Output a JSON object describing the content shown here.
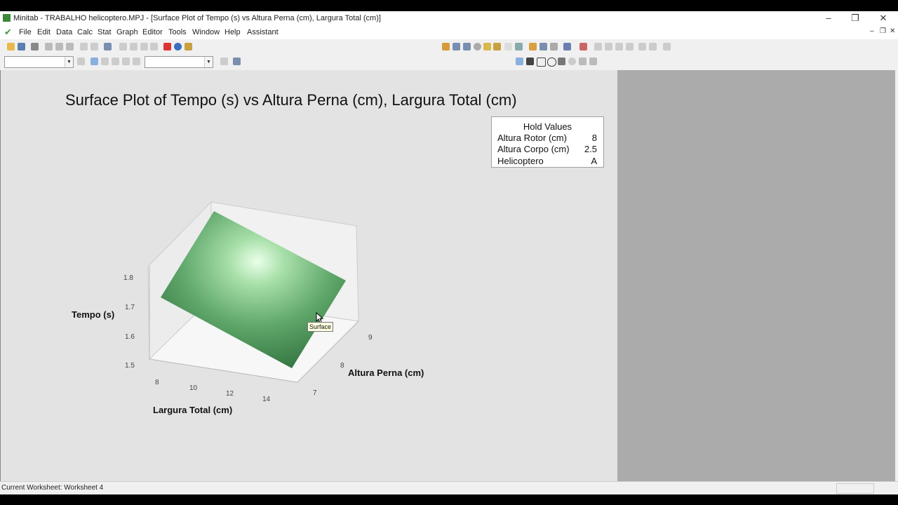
{
  "window": {
    "title": "Minitab - TRABALHO helicoptero.MPJ - [Surface Plot of Tempo (s) vs Altura Perna (cm), Largura Total (cm)]"
  },
  "menu": [
    "File",
    "Edit",
    "Data",
    "Calc",
    "Stat",
    "Graph",
    "Editor",
    "Tools",
    "Window",
    "Help",
    "Assistant"
  ],
  "plot": {
    "title": "Surface Plot of Tempo (s) vs Altura Perna (cm), Largura Total (cm)",
    "hold": {
      "header": "Hold Values",
      "rows": [
        {
          "label": "Altura Rotor (cm)",
          "value": "8"
        },
        {
          "label": "Altura Corpo (cm)",
          "value": "2.5"
        },
        {
          "label": "Helicoptero",
          "value": "A"
        }
      ]
    },
    "tooltip": "Surface"
  },
  "chart_data": {
    "type": "surface",
    "title": "Surface Plot of Tempo (s) vs Altura Perna (cm), Largura Total (cm)",
    "xlabel": "Largura Total (cm)",
    "ylabel": "Altura Perna (cm)",
    "zlabel": "Tempo (s)",
    "x_ticks": [
      "8",
      "10",
      "12",
      "14"
    ],
    "y_ticks": [
      "7",
      "8",
      "9"
    ],
    "z_ticks": [
      "1.5",
      "1.6",
      "1.7",
      "1.8"
    ],
    "surface_color": "#3f8a48"
  },
  "status": {
    "text": "Current Worksheet: Worksheet 4"
  }
}
